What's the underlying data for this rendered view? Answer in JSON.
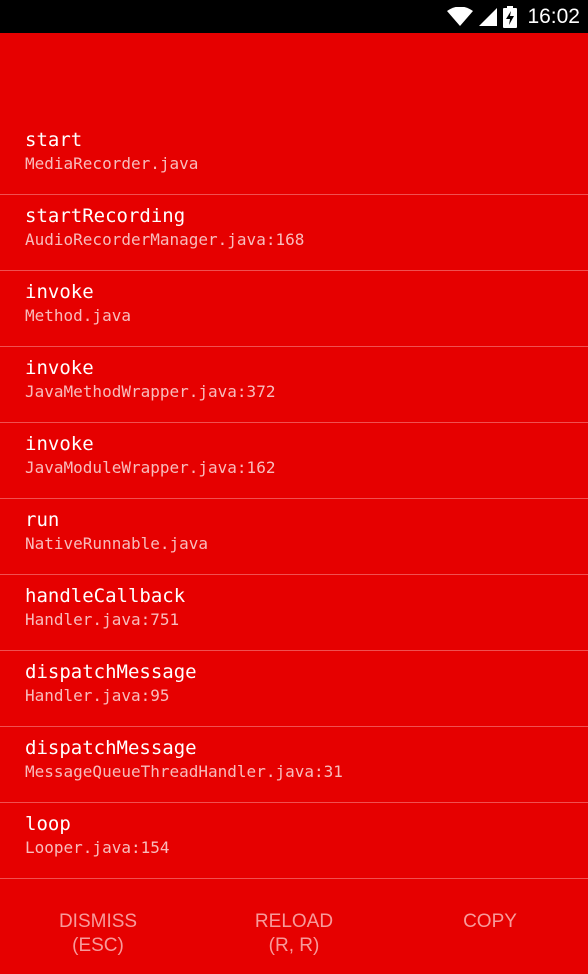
{
  "status_bar": {
    "time": "16:02",
    "icons": [
      "wifi-icon",
      "signal-icon",
      "battery-charging-icon"
    ]
  },
  "stack_frames": [
    {
      "method": "start",
      "file": "MediaRecorder.java"
    },
    {
      "method": "startRecording",
      "file": "AudioRecorderManager.java:168"
    },
    {
      "method": "invoke",
      "file": "Method.java"
    },
    {
      "method": "invoke",
      "file": "JavaMethodWrapper.java:372"
    },
    {
      "method": "invoke",
      "file": "JavaModuleWrapper.java:162"
    },
    {
      "method": "run",
      "file": "NativeRunnable.java"
    },
    {
      "method": "handleCallback",
      "file": "Handler.java:751"
    },
    {
      "method": "dispatchMessage",
      "file": "Handler.java:95"
    },
    {
      "method": "dispatchMessage",
      "file": "MessageQueueThreadHandler.java:31"
    },
    {
      "method": "loop",
      "file": "Looper.java:154"
    }
  ],
  "actions": {
    "dismiss": {
      "label": "DISMISS",
      "shortcut": "(ESC)"
    },
    "reload": {
      "label": "RELOAD",
      "shortcut": "(R, R)"
    },
    "copy": {
      "label": "COPY"
    }
  },
  "colors": {
    "background": "#e60000",
    "status_bar": "#000000",
    "divider": "#f05050",
    "file_text": "#f8bcbc",
    "action_text": "#f79a9a"
  }
}
